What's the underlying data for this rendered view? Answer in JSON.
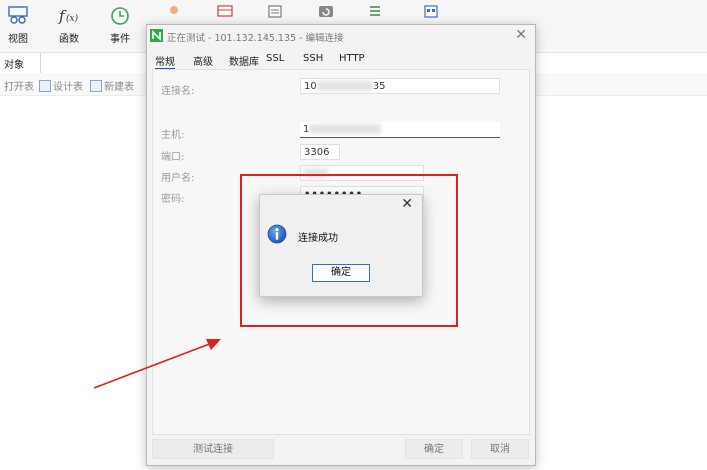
{
  "toolbar": {
    "items": [
      {
        "label": "视图",
        "icon": "view-icon"
      },
      {
        "label": "函数",
        "icon": "function-icon"
      },
      {
        "label": "事件",
        "icon": "event-icon"
      },
      {
        "label": "",
        "icon": "user-icon"
      },
      {
        "label": "",
        "icon": "table-icon"
      },
      {
        "label": "",
        "icon": "query-icon"
      },
      {
        "label": "",
        "icon": "backup-icon"
      },
      {
        "label": "",
        "icon": "schedule-icon"
      },
      {
        "label": "",
        "icon": "model-icon"
      }
    ]
  },
  "objects_tab": {
    "label": "对象"
  },
  "object_toolbar": {
    "open_table": "打开表",
    "design_table": "设计表",
    "new_table": "新建表"
  },
  "connection_dialog": {
    "title": "正在测试 - 101.132.145.135 - 编辑连接",
    "tabs": [
      "常规",
      "高级",
      "数据库",
      "SSL",
      "SSH",
      "HTTP"
    ],
    "fields": {
      "connection_name": {
        "label": "连接名:",
        "value_prefix": "10",
        "value_suffix": "35"
      },
      "host": {
        "label": "主机:",
        "value_prefix": "1"
      },
      "port": {
        "label": "端口:",
        "value": "3306"
      },
      "username": {
        "label": "用户名:"
      },
      "password": {
        "label": "密码:",
        "value": "••••••••"
      }
    },
    "buttons": {
      "test_connection": "测试连接",
      "ok": "确定",
      "cancel": "取消"
    }
  },
  "message_box": {
    "message": "连接成功",
    "ok_label": "确定"
  },
  "colors": {
    "annotation_red": "#e02020",
    "accent_blue": "#2b6fd1",
    "navicat_green": "#2fa84f"
  }
}
